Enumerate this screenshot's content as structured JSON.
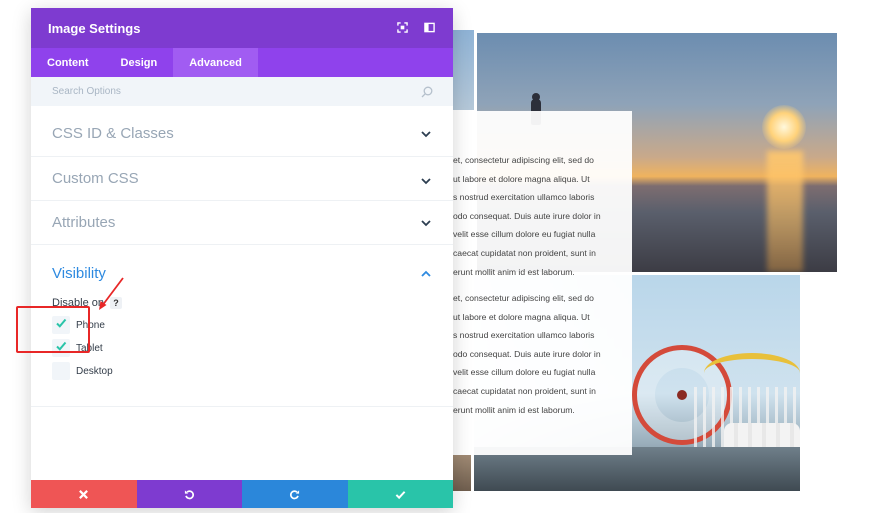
{
  "background": {
    "paragraph_lines_1": [
      "et, consectetur adipiscing elit, sed do",
      "ut labore et dolore magna aliqua. Ut",
      "s nostrud exercitation ullamco laboris",
      "odo consequat. Duis aute irure dolor in",
      "velit esse cillum dolore eu fugiat nulla",
      "caecat cupidatat non proident, sunt in",
      "erunt mollit anim id est laborum."
    ],
    "paragraph_lines_2": [
      "et, consectetur adipiscing elit, sed do",
      "ut labore et dolore magna aliqua. Ut",
      "s nostrud exercitation ullamco laboris",
      "odo consequat. Duis aute irure dolor in",
      "velit esse cillum dolore eu fugiat nulla",
      "caecat cupidatat non proident, sunt in",
      "erunt mollit anim id est laborum."
    ]
  },
  "modal": {
    "title": "Image Settings",
    "header_icons": [
      "expand-icon",
      "sidebar-toggle-icon"
    ],
    "tabs": [
      {
        "label": "Content",
        "active": false
      },
      {
        "label": "Design",
        "active": false
      },
      {
        "label": "Advanced",
        "active": true
      }
    ],
    "search": {
      "placeholder": "Search Options",
      "icon": "search-icon"
    },
    "sections": {
      "css": {
        "title": "CSS ID & Classes",
        "expanded": false
      },
      "custom_css": {
        "title": "Custom CSS",
        "expanded": false
      },
      "attributes": {
        "title": "Attributes",
        "expanded": false
      },
      "visibility": {
        "title": "Visibility",
        "expanded": true,
        "disable_on_label": "Disable on",
        "help_label": "?",
        "options": [
          {
            "label": "Phone",
            "checked": true
          },
          {
            "label": "Tablet",
            "checked": true
          },
          {
            "label": "Desktop",
            "checked": false
          }
        ]
      }
    },
    "footer_buttons": [
      "discard-icon",
      "undo-icon",
      "redo-icon",
      "save-check-icon"
    ]
  },
  "colors": {
    "header_purple": "#7e3bd0",
    "tab_purple": "#8f42ec",
    "active_tab": "#a15cf2",
    "visibility_blue": "#2e8ae0",
    "check_teal": "#29c4a9",
    "discard_red": "#ef5555",
    "redo_blue": "#2b87da",
    "annotation_red": "#e82727"
  }
}
